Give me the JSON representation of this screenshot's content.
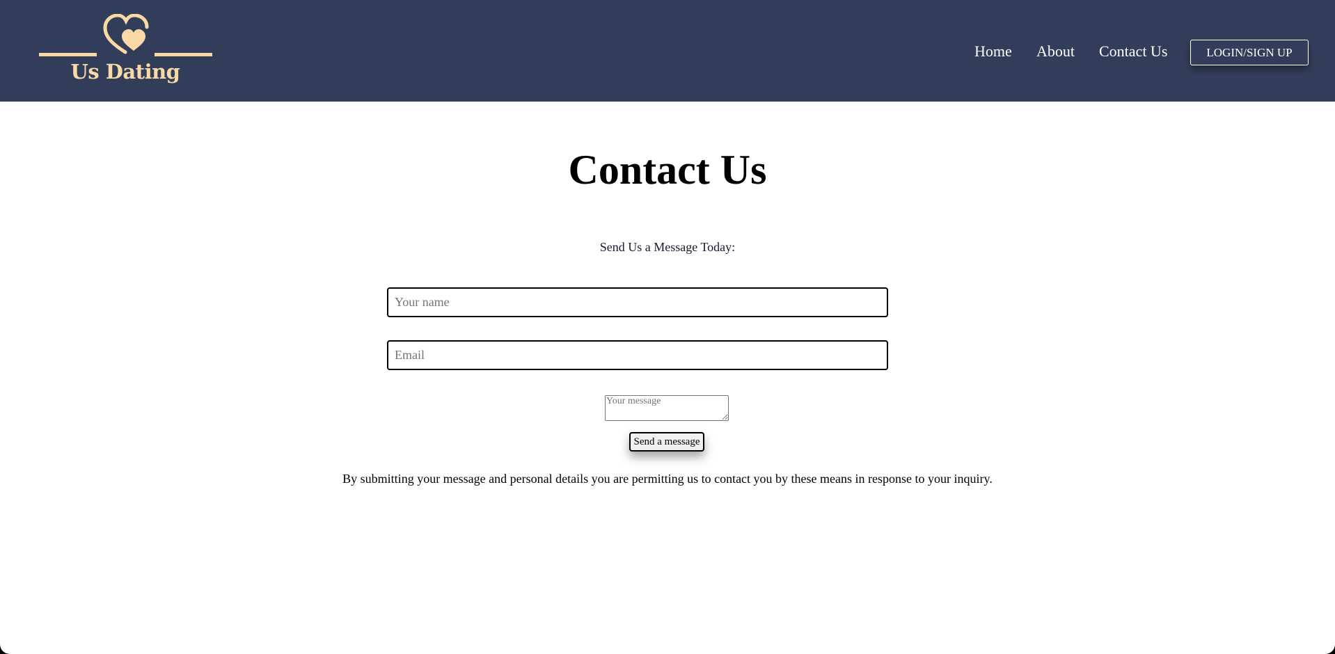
{
  "colors": {
    "navbar_bg": "#323e59",
    "logo_accent": "#f9d9a6",
    "nav_text": "#ffffff",
    "page_bg": "#ffffff"
  },
  "logo": {
    "text": "Us Dating",
    "icon": "double-heart-icon"
  },
  "nav": {
    "items": [
      {
        "label": "Home"
      },
      {
        "label": "About"
      },
      {
        "label": "Contact Us"
      }
    ],
    "login_label": "LOGIN/SIGN UP"
  },
  "main": {
    "title": "Contact Us",
    "subtitle": "Send Us a Message Today:",
    "form": {
      "name_placeholder": "Your name",
      "email_placeholder": "Email",
      "message_placeholder": "Your message",
      "submit_label": "Send a message"
    },
    "disclaimer": "By submitting your message and personal details you are permitting us to contact you by these means in response to your inquiry."
  }
}
